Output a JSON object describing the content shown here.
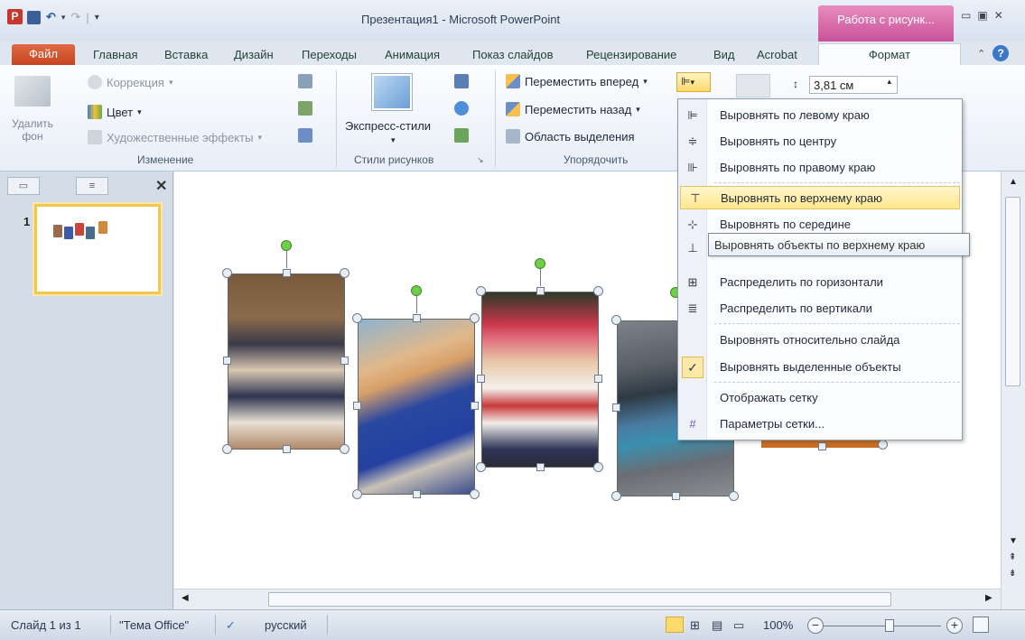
{
  "window": {
    "title": "Презентация1 - Microsoft PowerPoint",
    "app_icon_letter": "P",
    "context_tab_group": "Работа с рисунк...",
    "controls": [
      "▭",
      "▣",
      "✕"
    ]
  },
  "ribbon_tabs": [
    "Файл",
    "Главная",
    "Вставка",
    "Дизайн",
    "Переходы",
    "Анимация",
    "Показ слайдов",
    "Рецензирование",
    "Вид",
    "Acrobat",
    "Формат"
  ],
  "ribbon": {
    "remove_bg": {
      "line1": "Удалить",
      "line2": "фон"
    },
    "correction": "Коррекция",
    "color": "Цвет",
    "art_effects": "Художественные эффекты",
    "group_change": "Изменение",
    "express_styles": "Экспресс-стили",
    "group_styles": "Стили рисунков",
    "bring_forward": "Переместить вперед",
    "send_backward": "Переместить назад",
    "selection_pane": "Область выделения",
    "group_arrange": "Упорядочить",
    "height_value": "3,81 см"
  },
  "left_panel": {
    "slide_number": "1"
  },
  "menu": {
    "items": [
      {
        "label": "Выровнять по левому краю",
        "icon": "align-left-icon",
        "glyph": "⊫"
      },
      {
        "label": "Выровнять по центру",
        "icon": "align-center-icon",
        "glyph": "≑"
      },
      {
        "label": "Выровнять по правому краю",
        "icon": "align-right-icon",
        "glyph": "⊪"
      },
      {
        "label": "Выровнять по верхнему краю",
        "icon": "align-top-icon",
        "glyph": "⊤"
      },
      {
        "label": "Выровнять по середине",
        "icon": "align-middle-icon",
        "glyph": "⊹"
      },
      {
        "label": "Распределить по горизонтали",
        "icon": "distribute-horizontal-icon",
        "glyph": "⊞"
      },
      {
        "label": "Распределить по вертикали",
        "icon": "distribute-vertical-icon",
        "glyph": "≣"
      },
      {
        "label": "Выровнять относительно слайда",
        "icon": "",
        "glyph": ""
      },
      {
        "label": "Выровнять выделенные объекты",
        "icon": "check-icon",
        "glyph": "✓"
      },
      {
        "label": "Отображать сетку",
        "icon": "",
        "glyph": ""
      },
      {
        "label": "Параметры сетки...",
        "icon": "grid-icon",
        "glyph": "#"
      }
    ],
    "highlighted_index": 3,
    "tooltip": "Выровнять объекты по верхнему краю"
  },
  "status_bar": {
    "slide_info": "Слайд 1 из 1",
    "theme": "\"Тема Office\"",
    "language": "русский",
    "zoom": "100%"
  },
  "colors": {
    "accent": "#c9519a",
    "file_tab": "#d0522a",
    "highlight": "#ffe78c"
  }
}
